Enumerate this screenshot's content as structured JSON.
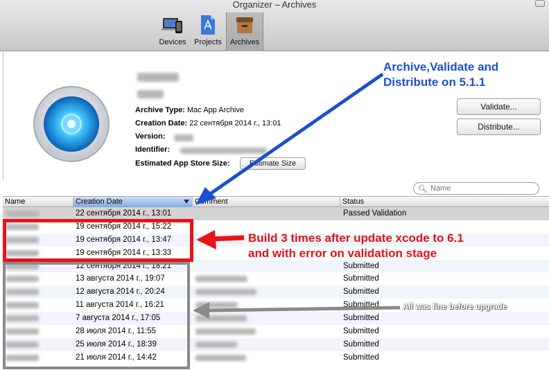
{
  "window": {
    "title": "Organizer – Archives"
  },
  "toolbar": {
    "tabs": [
      {
        "label": "Devices",
        "icon": "devices-icon"
      },
      {
        "label": "Projects",
        "icon": "projects-icon"
      },
      {
        "label": "Archives",
        "icon": "archives-icon",
        "selected": true
      }
    ]
  },
  "archive": {
    "type_label": "Archive Type:",
    "type_value": "Mac App Archive",
    "creation_label": "Creation Date:",
    "creation_value": "22 сентября 2014 г., 13:01",
    "version_label": "Version:",
    "identifier_label": "Identifier:",
    "size_label": "Estimated App Store Size:",
    "estimate_button": "Estimate Size",
    "validate_button": "Validate...",
    "distribute_button": "Distribute..."
  },
  "search": {
    "placeholder": "Name"
  },
  "table": {
    "columns": [
      "Name",
      "Creation Date",
      "Comment",
      "Status"
    ],
    "rows": [
      {
        "date": "22 сентября 2014 г., 13:01",
        "status": "Passed Validation",
        "selected": true
      },
      {
        "date": "19 сентября 2014 г., 15:22",
        "status": ""
      },
      {
        "date": "19 сентября 2014 г., 13:47",
        "status": ""
      },
      {
        "date": "19 сентября 2014 г., 13:33",
        "status": ""
      },
      {
        "date": "12 сентября 2014 г., 18:21",
        "status": "Submitted"
      },
      {
        "date": "13 августа 2014 г., 19:07",
        "status": "Submitted"
      },
      {
        "date": "12 августа 2014 г., 20:24",
        "status": "Submitted"
      },
      {
        "date": "11 августа 2014 г., 16:21",
        "status": "Submitted"
      },
      {
        "date": "7 августа 2014 г., 17:05",
        "status": "Submitted"
      },
      {
        "date": "28 июля 2014 г., 11:55",
        "status": "Submitted"
      },
      {
        "date": "25 июля 2014 г., 18:39",
        "status": "Submitted"
      },
      {
        "date": "21 июля 2014 г., 14:42",
        "status": "Submitted"
      }
    ]
  },
  "annotations": {
    "blue_line1": "Archive,Validate and",
    "blue_line2": "Distribute on 5.1.1",
    "red_line1": "Build 3 times after update xcode to 6.1",
    "red_line2": "and with error on validation stage",
    "gray": "All was fine before upgrade"
  },
  "colors": {
    "blue_annotation": "#1a4fd0",
    "red_annotation": "#e8141a",
    "gray_annotation": "#8a8a8a",
    "selected_row": "#d4d4d4"
  }
}
